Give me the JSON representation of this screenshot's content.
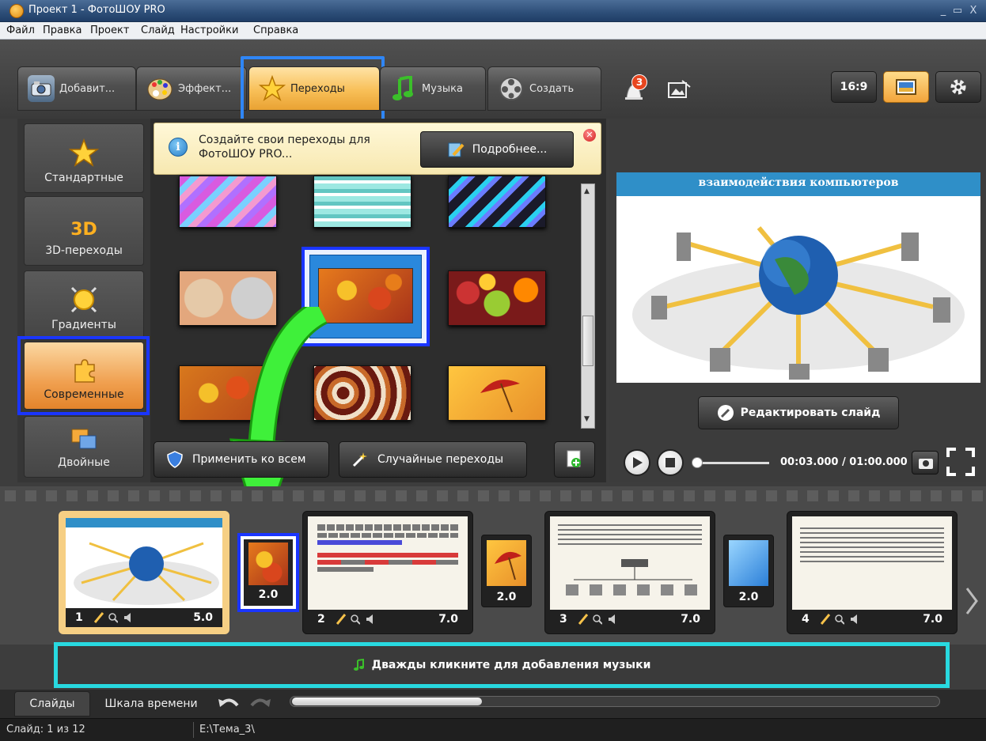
{
  "window": {
    "title": "Проект 1 - ФотоШОУ PRO",
    "min": "_",
    "max": "▭",
    "close": "X"
  },
  "menu": [
    "Файл",
    "Правка",
    "Проект",
    "Слайд",
    "Настройки",
    "Справка"
  ],
  "tabs": [
    {
      "label": "Добавит...",
      "icon": "camera-icon"
    },
    {
      "label": "Эффект...",
      "icon": "palette-icon"
    },
    {
      "label": "Переходы",
      "icon": "star-icon",
      "active": true
    },
    {
      "label": "Музыка",
      "icon": "music-note-icon"
    },
    {
      "label": "Создать",
      "icon": "film-reel-icon"
    }
  ],
  "toolbar": {
    "notifications_count": "3",
    "aspect": "16:9"
  },
  "categories": [
    {
      "label": "Стандартные",
      "icon": "star-icon"
    },
    {
      "label": "3D-переходы",
      "icon_text": "3D"
    },
    {
      "label": "Градиенты",
      "icon": "sun-icon"
    },
    {
      "label": "Современные",
      "icon": "puzzle-icon",
      "active": true
    },
    {
      "label": "Двойные",
      "icon": "double-icon"
    }
  ],
  "info": {
    "text": "Создайте свои переходы для ФотоШОУ PRO...",
    "button": "Подробнее..."
  },
  "gallery_buttons": {
    "apply_all": "Применить ко всем",
    "random": "Случайные переходы"
  },
  "preview": {
    "slide_title": "взаимодействия компьютеров",
    "edit_button": "Редактировать слайд",
    "time": "00:03.000 / 01:00.000"
  },
  "slides": [
    {
      "num": "1",
      "duration": "5.0"
    },
    {
      "num": "2",
      "duration": "7.0"
    },
    {
      "num": "3",
      "duration": "7.0"
    },
    {
      "num": "4",
      "duration": "7.0"
    }
  ],
  "transitions": [
    {
      "duration": "2.0"
    },
    {
      "duration": "2.0"
    },
    {
      "duration": "2.0"
    }
  ],
  "music": {
    "text": "Дважды кликните для добавления музыки"
  },
  "bottom_tabs": {
    "slides": "Слайды",
    "timeline": "Шкала времени"
  },
  "status": {
    "slide": "Слайд: 1 из 12",
    "path": "E:\\Тема_3\\"
  }
}
